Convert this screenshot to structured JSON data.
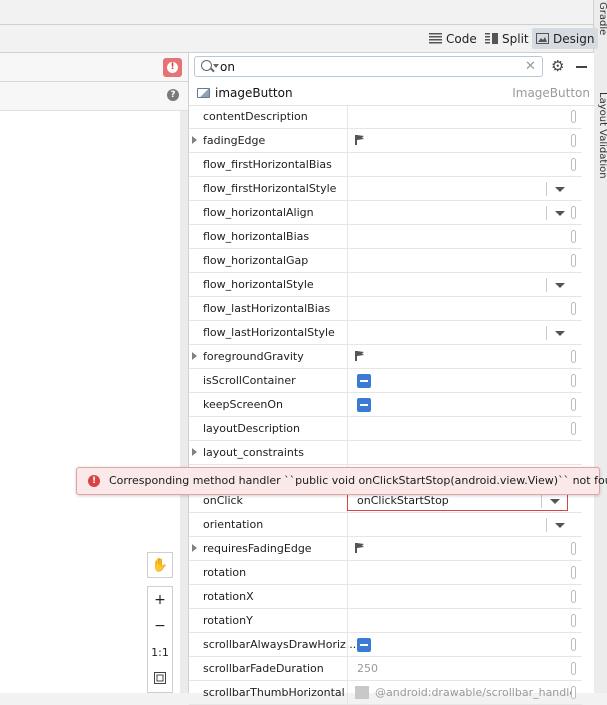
{
  "window": {
    "side_tab_top": "Gradle",
    "side_tab_bottom": "Layout Validation"
  },
  "toolbar": {
    "modes": [
      {
        "label": "Code",
        "icon": "code-lines-icon",
        "active": false
      },
      {
        "label": "Split",
        "icon": "split-icon",
        "active": false
      },
      {
        "label": "Design",
        "icon": "image-icon",
        "active": true
      }
    ]
  },
  "search": {
    "value": "on",
    "placeholder": ""
  },
  "component": {
    "name": "imageButton",
    "type": "ImageButton"
  },
  "attributes": [
    {
      "name": "contentDescription",
      "value": "",
      "control": "picker"
    },
    {
      "name": "fadingEdge",
      "value": "",
      "control": "flag",
      "expandable": true
    },
    {
      "name": "flow_firstHorizontalBias",
      "value": "",
      "control": "picker"
    },
    {
      "name": "flow_firstHorizontalStyle",
      "value": "",
      "control": "dropdown"
    },
    {
      "name": "flow_horizontalAlign",
      "value": "",
      "control": "dropdown_picker"
    },
    {
      "name": "flow_horizontalBias",
      "value": "",
      "control": "picker"
    },
    {
      "name": "flow_horizontalGap",
      "value": "",
      "control": "picker"
    },
    {
      "name": "flow_horizontalStyle",
      "value": "",
      "control": "dropdown"
    },
    {
      "name": "flow_lastHorizontalBias",
      "value": "",
      "control": "picker"
    },
    {
      "name": "flow_lastHorizontalStyle",
      "value": "",
      "control": "dropdown"
    },
    {
      "name": "foregroundGravity",
      "value": "",
      "control": "flag",
      "expandable": true
    },
    {
      "name": "isScrollContainer",
      "value": "",
      "control": "checkbox"
    },
    {
      "name": "keepScreenOn",
      "value": "",
      "control": "checkbox"
    },
    {
      "name": "layoutDescription",
      "value": "",
      "control": "picker"
    },
    {
      "name": "layout_constraints",
      "value": "",
      "control": "none",
      "expandable": true
    },
    {
      "name": "",
      "value": "",
      "control": "none"
    },
    {
      "name": "onClick",
      "value": "onClickStartStop",
      "control": "dropdown",
      "error": true
    },
    {
      "name": "orientation",
      "value": "",
      "control": "dropdown"
    },
    {
      "name": "requiresFadingEdge",
      "value": "",
      "control": "flag",
      "expandable": true
    },
    {
      "name": "rotation",
      "value": "",
      "control": "picker"
    },
    {
      "name": "rotationX",
      "value": "",
      "control": "picker"
    },
    {
      "name": "rotationY",
      "value": "",
      "control": "picker"
    },
    {
      "name": "scrollbarAlwaysDrawHoriz...",
      "value": "",
      "control": "checkbox"
    },
    {
      "name": "scrollbarFadeDuration",
      "value": "250",
      "control": "picker",
      "muted": true
    },
    {
      "name": "scrollbarThumbHorizontal",
      "value": "@android:drawable/scrollbar_handle",
      "control": "swatch",
      "muted": true
    }
  ],
  "error_tooltip": {
    "message": "Corresponding method handler ``public void onClickStartStop(android.view.View)`` not found"
  },
  "canvas_tools": {
    "zoom_in": "+",
    "zoom_out": "−",
    "actual_size": "1:1"
  }
}
